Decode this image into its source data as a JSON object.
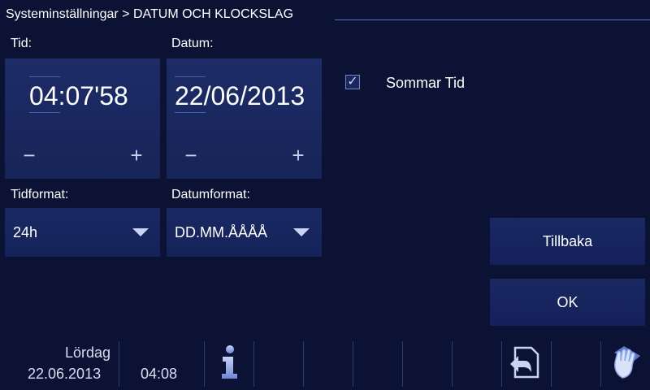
{
  "header": {
    "breadcrumb": "Systeminställningar > DATUM OCH KLOCKSLAG"
  },
  "time": {
    "label": "Tid:",
    "value": "04:07'58",
    "minus": "−",
    "plus": "+"
  },
  "date": {
    "label": "Datum:",
    "value": "22/06/2013",
    "minus": "−",
    "plus": "+"
  },
  "time_format": {
    "label": "Tidformat:",
    "value": "24h"
  },
  "date_format": {
    "label": "Datumformat:",
    "value": "DD.MM.ÅÅÅÅ"
  },
  "daylight_saving": {
    "label": "Sommar Tid",
    "checked": true,
    "check_glyph": "✓"
  },
  "buttons": {
    "back": "Tillbaka",
    "ok": "OK"
  },
  "statusbar": {
    "day": "Lördag",
    "date": "22.06.2013",
    "time": "04:08",
    "icons": [
      "info-icon",
      "return-icon",
      "cleaning-hand-icon"
    ]
  },
  "colors": {
    "background": "#0c1233",
    "panel": "#1a2962",
    "accent_icon": "#8fa8e8"
  }
}
